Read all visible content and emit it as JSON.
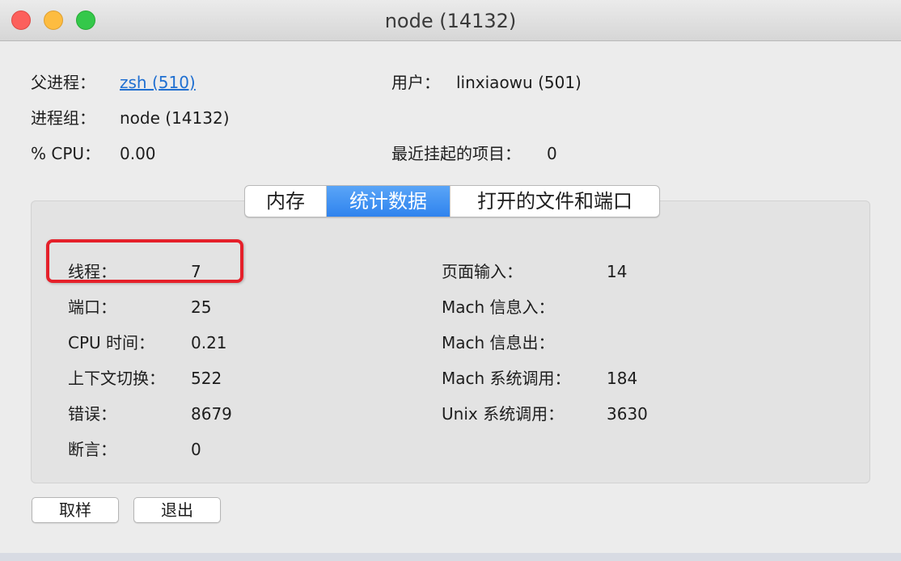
{
  "window": {
    "title": "node (14132)"
  },
  "info": {
    "parent_label": "父进程：",
    "parent_value": "zsh (510)",
    "user_label": "用户：",
    "user_value": "linxiaowu (501)",
    "group_label": "进程组：",
    "group_value": "node (14132)",
    "cpu_label": "% CPU：",
    "cpu_value": "0.00",
    "hangs_label": "最近挂起的项目：",
    "hangs_value": "0"
  },
  "tabs": [
    {
      "label": "内存",
      "active": false
    },
    {
      "label": "统计数据",
      "active": true
    },
    {
      "label": "打开的文件和端口",
      "active": false
    }
  ],
  "stats_left": [
    {
      "label": "线程：",
      "value": "7"
    },
    {
      "label": "端口：",
      "value": "25"
    },
    {
      "label": "CPU 时间：",
      "value": "0.21"
    },
    {
      "label": "上下文切换：",
      "value": "522"
    },
    {
      "label": "错误：",
      "value": "8679"
    },
    {
      "label": "断言：",
      "value": "0"
    }
  ],
  "stats_right": [
    {
      "label": "页面输入：",
      "value": "14"
    },
    {
      "label": "Mach 信息入：",
      "value": ""
    },
    {
      "label": "Mach 信息出：",
      "value": ""
    },
    {
      "label": "Mach 系统调用：",
      "value": "184"
    },
    {
      "label": "Unix 系统调用：",
      "value": "3630"
    }
  ],
  "buttons": {
    "sample": "取样",
    "quit": "退出"
  },
  "colors": {
    "tab_active": "#2f83ee",
    "highlight": "#e5202a",
    "link": "#1f6fd1"
  }
}
